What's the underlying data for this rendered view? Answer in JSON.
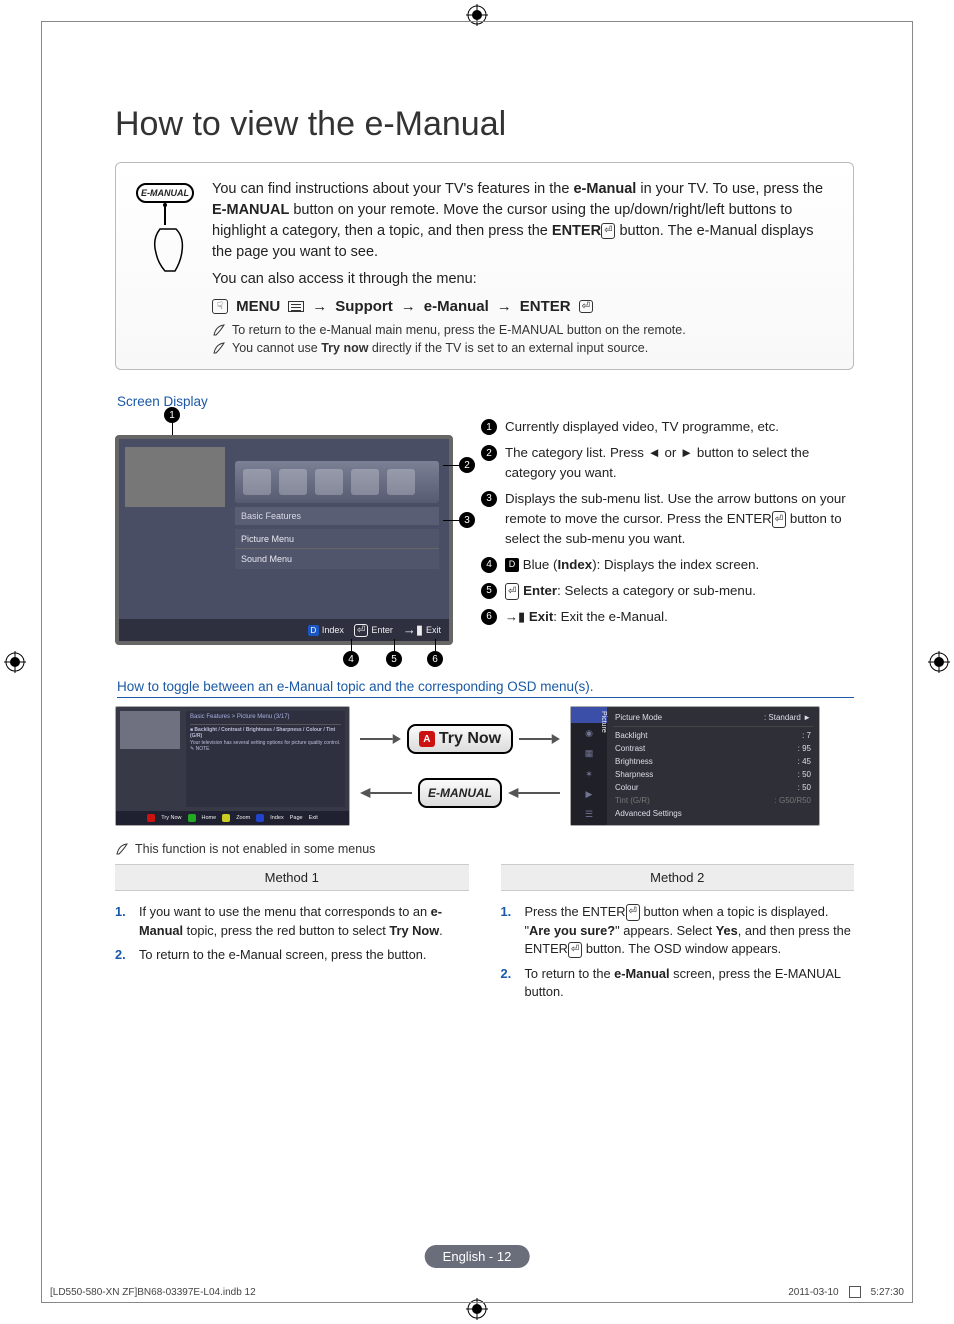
{
  "title": "How to view the e-Manual",
  "remote_button_label": "E-MANUAL",
  "intro": {
    "p1_a": "You can find instructions about your TV's features in the ",
    "p1_b": "e-Manual",
    "p1_c": " in your TV. To use, press the ",
    "p1_d": "E-MANUAL",
    "p1_e": " button on your remote. Move the cursor using the up/down/right/left buttons to highlight a category, then a topic, and then press the ",
    "p1_f": "ENTER",
    "p1_g": " button. The e-Manual displays the page you want to see.",
    "p2": "You can also access it through the menu:"
  },
  "navpath": {
    "menu": "MENU",
    "arrow": "→",
    "support": "Support",
    "emanual": "e-Manual",
    "enter": "ENTER"
  },
  "notes": {
    "n1_a": "To return to the e-Manual main menu, press the ",
    "n1_b": "E-MANUAL",
    "n1_c": " button on the remote.",
    "n2_a": "You cannot use ",
    "n2_b": "Try now",
    "n2_c": " directly if the TV is set to an external input source."
  },
  "screen_display_label": "Screen Display",
  "mock": {
    "category_header": "Basic Features",
    "sub1": "Picture Menu",
    "sub2": "Sound Menu",
    "foot_index": "Index",
    "foot_enter": "Enter",
    "foot_exit": "Exit",
    "foot_d": "D"
  },
  "legend": {
    "l1": "Currently displayed video, TV programme, etc.",
    "l2_a": "The category list. Press ◄ or ► button to select the category you want.",
    "l3_a": "Displays the sub-menu list. Use the arrow buttons on your remote to move the cursor. Press the ",
    "l3_b": "ENTER",
    "l3_c": " button to select the sub-menu you want.",
    "l4_a": "Blue (",
    "l4_b": "Index",
    "l4_c": "): Displays the index screen.",
    "l5_a": "Enter",
    "l5_b": ": Selects a category or sub-menu.",
    "l6_a": "Exit",
    "l6_b": ": Exit the e-Manual."
  },
  "toggle_label": "How to toggle between an e-Manual topic and the corresponding OSD menu(s).",
  "p1_panel": {
    "crumb": "Basic Features > Picture Menu (3/17)",
    "line1": "Backlight / Contrast / Brightness / Sharpness / Colour / Tint (G/R)",
    "line2": "Your television has several setting options for picture quality control.",
    "note_label": "NOTE",
    "foot_try": "Try Now",
    "foot_home": "Home",
    "foot_zoom": "Zoom",
    "foot_index": "Index",
    "foot_page": "Page",
    "foot_exit": "Exit"
  },
  "bigbtn_try": "Try Now",
  "bigbtn_em": "E-MANUAL",
  "osd": {
    "side_tab": "Picture",
    "rows": [
      {
        "k": "Picture Mode",
        "v": ": Standard"
      },
      {
        "k": "Backlight",
        "v": ": 7"
      },
      {
        "k": "Contrast",
        "v": ": 95"
      },
      {
        "k": "Brightness",
        "v": ": 45"
      },
      {
        "k": "Sharpness",
        "v": ": 50"
      },
      {
        "k": "Colour",
        "v": ": 50"
      },
      {
        "k": "Tint (G/R)",
        "v": ": G50/R50"
      },
      {
        "k": "Advanced Settings",
        "v": ""
      }
    ]
  },
  "fn_note": "This function is not enabled in some menus",
  "method1_title": "Method 1",
  "method2_title": "Method 2",
  "method1": {
    "s1_a": "If you want to use the menu that corresponds to an ",
    "s1_b": "e-Manual",
    "s1_c": " topic, press the red button to select ",
    "s1_d": "Try Now",
    "s1_e": ".",
    "s2": "To return to the e-Manual screen, press the  button."
  },
  "method2": {
    "s1_a": "Press the ",
    "s1_b": "ENTER",
    "s1_c": " button when a topic is displayed. \"",
    "s1_d": "Are you sure?",
    "s1_e": "\" appears. Select ",
    "s1_f": "Yes",
    "s1_g": ", and then press the ",
    "s1_h": "ENTER",
    "s1_i": " button. The OSD window appears.",
    "s2_a": "To return to the ",
    "s2_b": "e-Manual",
    "s2_c": " screen, press the ",
    "s2_d": "E-MANUAL",
    "s2_e": " button."
  },
  "page_badge": "English - 12",
  "footer": {
    "left": "[LD550-580-XN ZF]BN68-03397E-L04.indb   12",
    "date": "2011-03-10",
    "time": "5:27:30"
  },
  "glyphs": {
    "enter": "⏎",
    "exit": "→▮",
    "remote": "☟",
    "d_letter": "D",
    "a_letter": "A",
    "menu_bars_aria": "menu"
  }
}
